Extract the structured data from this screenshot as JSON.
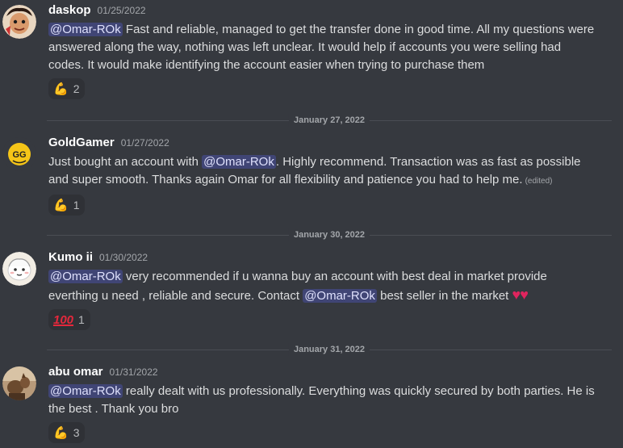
{
  "messages": [
    {
      "username": "daskop",
      "timestamp": "01/25/2022",
      "mention": "@Omar-ROk",
      "text": " Fast and reliable, managed to get the transfer done in good time. All my questions were answered along the way, nothing was left unclear. It would help if accounts you were selling had codes. It would make identifying the account easier when trying to purchase them",
      "reaction": {
        "emoji": "flexed-biceps",
        "count": "2"
      },
      "avatar_color": "#c9a27a"
    },
    {
      "username": "GoldGamer",
      "timestamp": "01/27/2022",
      "text_before": "Just bought an account with ",
      "mention": "@Omar-ROk",
      "text_after": ". Highly recommend. Transaction was as fast as possible and super smooth. Thanks again Omar for all flexibility and patience you had to help me.",
      "edited": "(edited)",
      "reaction": {
        "emoji": "flexed-biceps",
        "count": "1"
      },
      "avatar_color": "#f5c518"
    },
    {
      "username": "Kumo ii",
      "timestamp": "01/30/2022",
      "mention": "@Omar-ROk",
      "text_middle": "  very recommended if u wanna buy an account with best deal in market provide everthing u need , reliable and secure. Contact ",
      "mention2": "@Omar-ROk",
      "text_after": "  best seller in the market ",
      "hearts": "♥♥",
      "reaction": {
        "emoji": "hundred-points",
        "count": "1",
        "glyph": "100"
      },
      "avatar_color": "#f2ede4"
    },
    {
      "username": "abu omar",
      "timestamp": "01/31/2022",
      "mention": "@Omar-ROk",
      "text": " really dealt with us professionally.  Everything was quickly secured by both parties.  He is the best . Thank you bro",
      "reaction": {
        "emoji": "flexed-biceps",
        "count": "3"
      },
      "avatar_color": "#8a6a4a"
    }
  ],
  "dividers": [
    "January 27, 2022",
    "January 30, 2022",
    "January 31, 2022"
  ],
  "colors": {
    "background": "#36393f",
    "mention_bg": "#414675",
    "reaction_bg": "#2f3136",
    "divider": "#4a4d54",
    "heart": "#e0245e"
  }
}
